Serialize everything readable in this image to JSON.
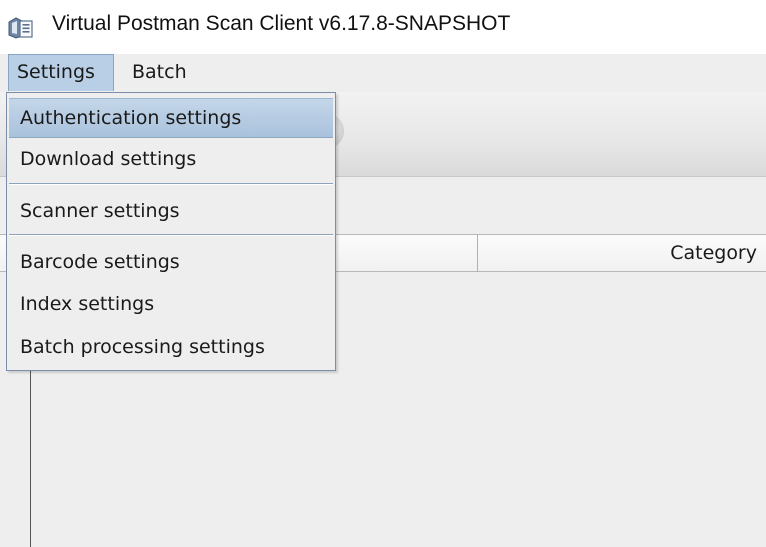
{
  "window": {
    "title": "Virtual Postman Scan Client v6.17.8-SNAPSHOT",
    "icon": "scanner-app-icon"
  },
  "menubar": {
    "items": [
      {
        "label": "Settings",
        "open": true
      },
      {
        "label": "Batch",
        "open": false
      }
    ]
  },
  "settings_menu": {
    "groups": [
      [
        {
          "label": "Authentication settings",
          "selected": true
        },
        {
          "label": "Download settings"
        }
      ],
      [
        {
          "label": "Scanner settings"
        }
      ],
      [
        {
          "label": "Barcode settings"
        },
        {
          "label": "Index settings"
        },
        {
          "label": "Batch processing settings"
        }
      ]
    ]
  },
  "table": {
    "columns": [
      "",
      "Category"
    ]
  },
  "colors": {
    "menu_highlight": "#b8cfe5",
    "window_background": "#eeeeee",
    "separator": "#8da3bd"
  }
}
